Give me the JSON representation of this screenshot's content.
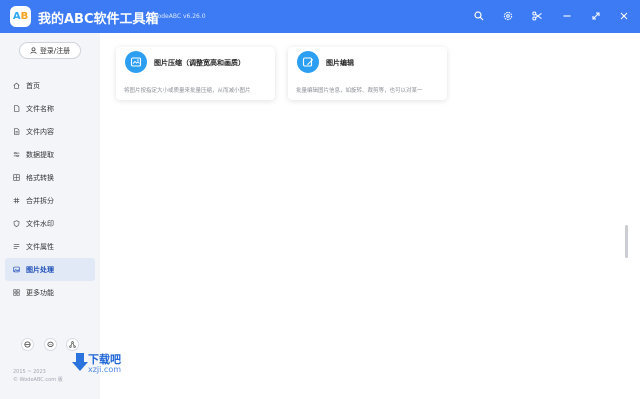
{
  "window": {
    "title": "我的ABC软件工具箱",
    "version": "WodeABC v6.26.0",
    "logo_text": "AB",
    "buttons": [
      "search-icon",
      "settings-icon",
      "scissors-icon",
      "minimize-icon",
      "maximize-icon",
      "close-icon"
    ]
  },
  "sidebar": {
    "login_label": "登录/注册",
    "items": [
      {
        "label": "首页",
        "icon": "home-icon"
      },
      {
        "label": "文件名称",
        "icon": "file-icon"
      },
      {
        "label": "文件内容",
        "icon": "file-content-icon"
      },
      {
        "label": "数据提取",
        "icon": "extract-icon"
      },
      {
        "label": "格式转换",
        "icon": "grid-icon"
      },
      {
        "label": "合并拆分",
        "icon": "hash-icon"
      },
      {
        "label": "文件水印",
        "icon": "shield-icon"
      },
      {
        "label": "文件属性",
        "icon": "list-icon"
      },
      {
        "label": "图片处理",
        "icon": "image-icon",
        "active": true
      },
      {
        "label": "更多功能",
        "icon": "more-icon"
      }
    ],
    "bottom_icons": [
      "browser-icon",
      "chat-icon",
      "share-icon"
    ],
    "copyright_line1": "2015 ~ 2023",
    "copyright_line2": "© WodeABC.com 版"
  },
  "main": {
    "cards": [
      {
        "title": "图片压缩（调整宽高和画质）",
        "description": "将图片按指定大小或质量来批量压缩，从而减小图片",
        "icon": "image-compress-icon"
      },
      {
        "title": "图片编辑",
        "description": "批量编辑图片信息，如旋转、裁剪等，也可以对某一",
        "icon": "image-edit-icon"
      }
    ]
  },
  "watermark": {
    "line1": "下载吧",
    "line2": "xzji.com"
  },
  "colors": {
    "titlebar": "#3d7bf5",
    "accent": "#2d9ff3",
    "sidebar_bg": "#f3f5f9",
    "active_bg": "#e2e9f6"
  }
}
